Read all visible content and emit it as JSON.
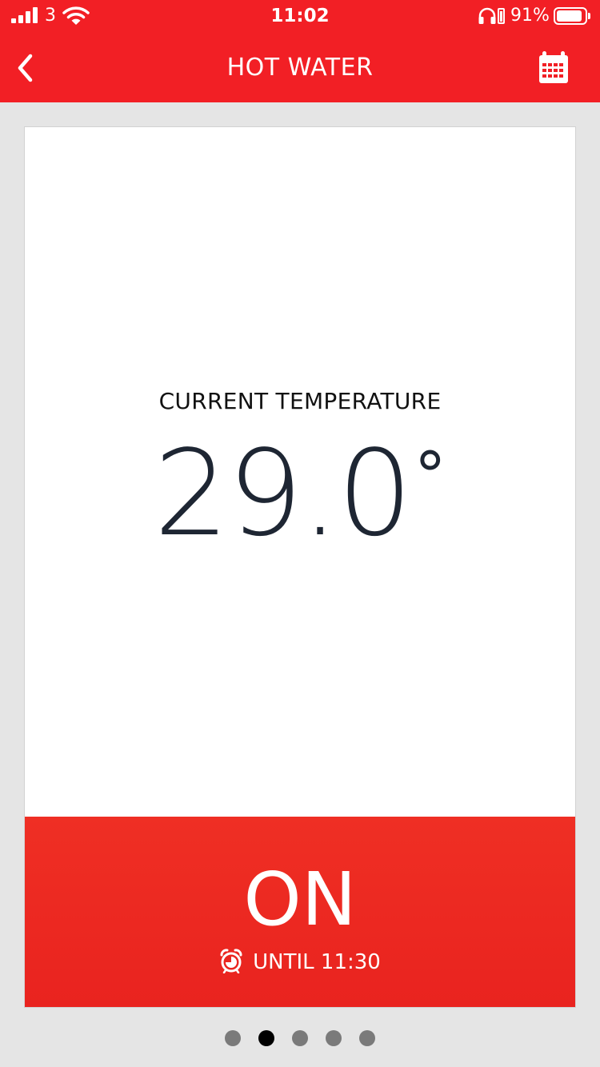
{
  "status_bar": {
    "carrier": "3",
    "time": "11:02",
    "battery_percent_label": "91%",
    "battery_level": 0.91
  },
  "nav": {
    "title": "HOT WATER",
    "back_icon": "chevron-left-icon",
    "right_icon": "calendar-icon"
  },
  "card": {
    "label": "CURRENT TEMPERATURE",
    "temperature": "29.0",
    "degree_symbol": "°"
  },
  "boost": {
    "state": "ON",
    "until_label": "UNTIL 11:30",
    "icon": "alarm-clock-icon"
  },
  "pager": {
    "count": 5,
    "active_index": 1
  },
  "colors": {
    "brand_red": "#f21f25",
    "panel_red": "#ec2a22",
    "temperature_text": "#1e2633",
    "background": "#e5e5e5"
  }
}
